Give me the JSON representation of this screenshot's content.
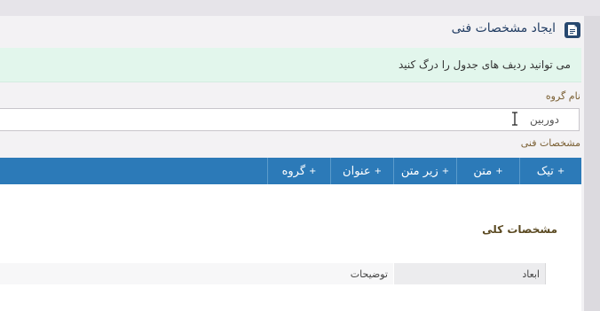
{
  "header": {
    "title": "ایجاد مشخصات فنی",
    "icon": "document-icon"
  },
  "info": {
    "message": "می توانید ردیف های جدول را درگ کنید"
  },
  "group": {
    "label": "نام گروه",
    "value": "دوربین"
  },
  "specs": {
    "label": "مشخصات فنی",
    "toolbar": [
      {
        "label": "تیک",
        "name": "add-check-button"
      },
      {
        "label": "متن",
        "name": "add-text-button"
      },
      {
        "label": "زیر متن",
        "name": "add-subtext-button"
      },
      {
        "label": "عنوان",
        "name": "add-title-button"
      },
      {
        "label": "گروه",
        "name": "add-group-button"
      }
    ],
    "plus_glyph": "+"
  },
  "table": {
    "section_title": "مشخصات کلی",
    "rows": [
      {
        "key": "ابعاد",
        "value": "توضیحات"
      }
    ]
  },
  "colors": {
    "accent": "#2c7ab8",
    "title": "#233e64",
    "info_bg": "#e2f6ec",
    "label": "#7a5f33"
  }
}
